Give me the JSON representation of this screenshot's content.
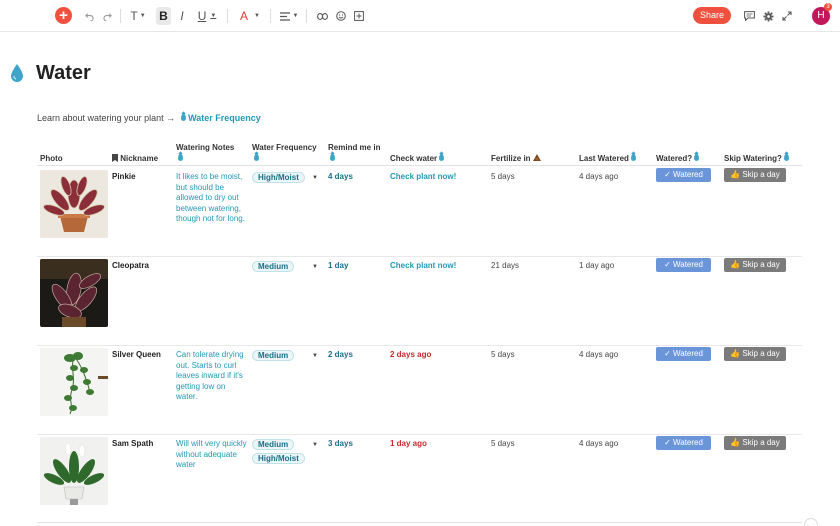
{
  "toolbar": {
    "add_icon": "plus-icon",
    "text_label": "T",
    "bold_label": "B",
    "italic_label": "I",
    "underline_label": "U",
    "font_color_label": "A",
    "share_label": "Share",
    "avatar_initial": "H",
    "notification_count": "3",
    "accent": "#f0513e"
  },
  "page": {
    "title": "Water",
    "intro_text": "Learn about watering your plant →",
    "intro_link": "Water Frequency"
  },
  "table": {
    "headers": {
      "photo": "Photo",
      "nickname": "Nickname",
      "notes": "Watering Notes",
      "frequency": "Water Frequency",
      "remind": "Remind me in",
      "check": "Check water",
      "fertilize": "Fertilize in",
      "last": "Last Watered",
      "watered": "Watered?",
      "skip": "Skip Watering?"
    },
    "rows": [
      {
        "nickname": "Pinkie",
        "notes": "It likes to be moist, but should be allowed to dry out between watering, though not for long.",
        "frequency": [
          "High/Moist"
        ],
        "remind": "4 days",
        "check": "Check plant now!",
        "check_status": "ok",
        "fertilize": "5 days",
        "last": "4 days ago",
        "watered_label": "✓ Watered",
        "skip_label": "👍 Skip a day"
      },
      {
        "nickname": "Cleopatra",
        "notes": "",
        "frequency": [
          "Medium"
        ],
        "remind": "1 day",
        "check": "Check plant now!",
        "check_status": "ok",
        "fertilize": "21 days",
        "last": "1 day ago",
        "watered_label": "✓ Watered",
        "skip_label": "👍 Skip a day"
      },
      {
        "nickname": "Silver Queen",
        "notes": "Can tolerate drying out. Starts to curl leaves inward if it's getting low on water.",
        "frequency": [
          "Medium"
        ],
        "remind": "2 days",
        "check": "2 days ago",
        "check_status": "late",
        "fertilize": "5 days",
        "last": "4 days ago",
        "watered_label": "✓ Watered",
        "skip_label": "👍 Skip a day"
      },
      {
        "nickname": "Sam Spath",
        "notes": "Will wilt very quickly without adequate water",
        "frequency": [
          "Medium",
          "High/Moist"
        ],
        "remind": "3 days",
        "check": "1 day ago",
        "check_status": "late",
        "fertilize": "5 days",
        "last": "4 days ago",
        "watered_label": "✓ Watered",
        "skip_label": "👍 Skip a day"
      }
    ]
  },
  "colors": {
    "teal_text": "#2199b5",
    "late_red": "#c62828",
    "watered_btn": "#6b95d9",
    "skip_btn": "#7b7b7b"
  }
}
